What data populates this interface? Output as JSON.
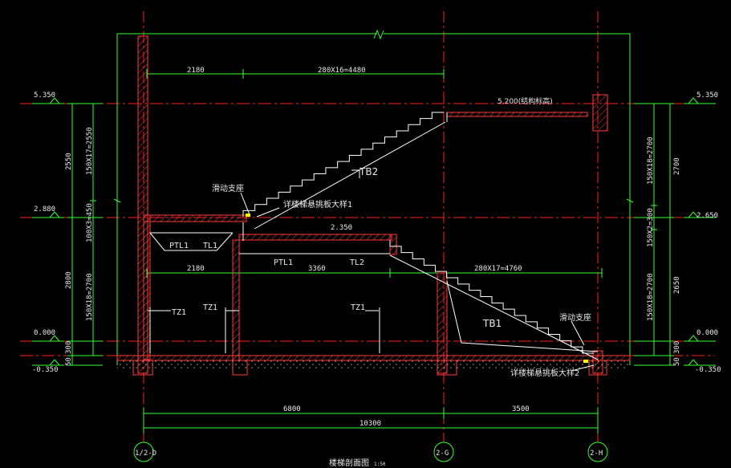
{
  "colors": {
    "background": "#000000",
    "wall_outline": "#ff3b3b",
    "dashed_axis": "#ff1e1e",
    "dimension": "#33ff33",
    "white_line": "#ffffff",
    "yellow_text": "#ffff00",
    "ground_hatch": "#d6d6d6"
  },
  "levels": {
    "left": [
      "5.350",
      "2.880",
      "0.000",
      "-0.350"
    ],
    "right": [
      "5.350",
      "2.650",
      "0.000",
      "-0.350"
    ]
  },
  "left_dims": {
    "outer": [
      "2550",
      "2800",
      "300",
      "50"
    ],
    "inner": [
      "150X17=2550",
      "100X3=450",
      "150X18=2700"
    ]
  },
  "right_dims": {
    "outer": [
      "2700",
      "2650",
      "300",
      "50"
    ],
    "inner": [
      "150X18=2700",
      "150X2=300",
      "150X18=2700"
    ]
  },
  "top_dims": {
    "left": "2180",
    "right": "280X16=4480"
  },
  "mid_dims": {
    "left": "2180",
    "center": "3360",
    "right": "280X17=4760"
  },
  "bottom_dims": {
    "left": "6800",
    "right": "3500",
    "total": "10300"
  },
  "axes": {
    "left": "1/2-D",
    "mid": "2-G",
    "right": "2-H"
  },
  "elevations": {
    "top_platform": "5.200(结构标高)",
    "mid_platform": "2.350"
  },
  "labels": {
    "tb2": "TB2",
    "tb1": "TB1",
    "ptl1_a": "PTL1",
    "tl1": "TL1",
    "ptl1_b": "PTL1",
    "tl2": "TL2",
    "tz1_a": "TZ1",
    "tz1_b": "TZ1",
    "tz1_c": "TZ1",
    "sliding_support_1": "滑动支座",
    "sliding_support_2": "滑动支座",
    "detail_1": "详楼梯悬挑板大样1",
    "detail_2": "详楼梯悬挑板大样2"
  },
  "title": "楼梯剖面图",
  "scale": "1:50"
}
